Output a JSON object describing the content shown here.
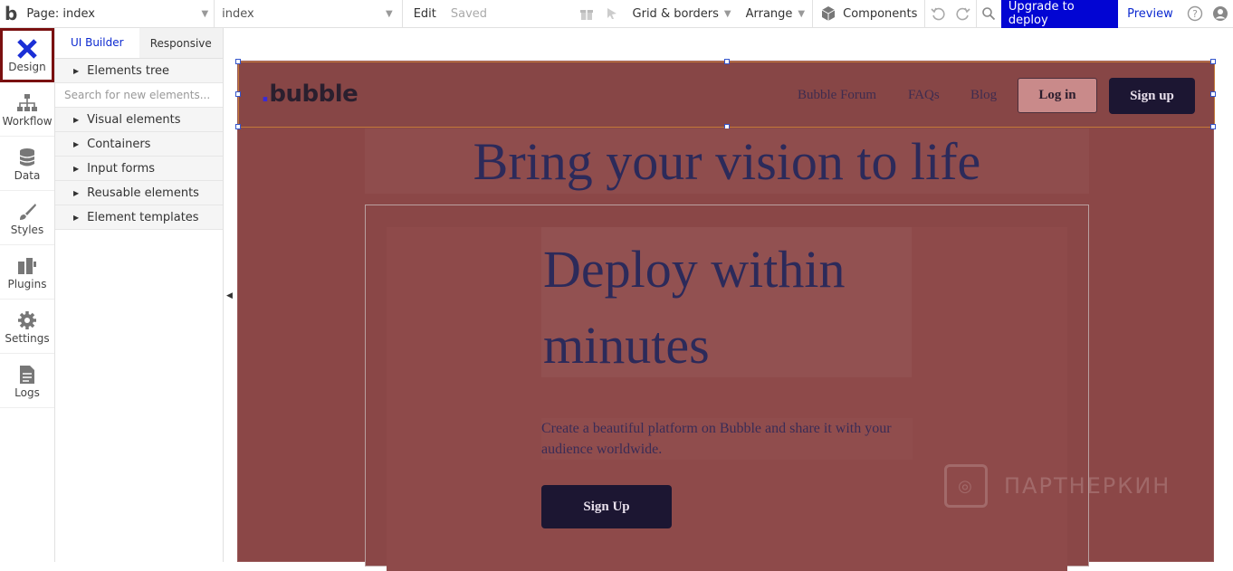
{
  "topbar": {
    "logo": "b",
    "page_label": "Page: index",
    "element_label": "index",
    "edit": "Edit",
    "saved": "Saved",
    "grid_borders": "Grid & borders",
    "arrange": "Arrange",
    "components": "Components",
    "upgrade": "Upgrade to deploy",
    "preview": "Preview",
    "accent": "#0205d3"
  },
  "sidebar": {
    "items": [
      {
        "label": "Design",
        "icon": "design-icon"
      },
      {
        "label": "Workflow",
        "icon": "workflow-icon"
      },
      {
        "label": "Data",
        "icon": "database-icon"
      },
      {
        "label": "Styles",
        "icon": "brush-icon"
      },
      {
        "label": "Plugins",
        "icon": "plug-icon"
      },
      {
        "label": "Settings",
        "icon": "gear-icon"
      },
      {
        "label": "Logs",
        "icon": "document-icon"
      }
    ]
  },
  "panel": {
    "tabs": [
      "UI Builder",
      "Responsive"
    ],
    "elements_tree": "Elements tree",
    "search_placeholder": "Search for new elements...",
    "categories": [
      "Visual elements",
      "Containers",
      "Input forms",
      "Reusable elements",
      "Element templates"
    ]
  },
  "canvas": {
    "logo": "bubble",
    "nav_links": [
      "Bubble Forum",
      "FAQs",
      "Blog"
    ],
    "login": "Log in",
    "signup": "Sign up",
    "hero_title": "Bring your vision to life",
    "deploy_title": "Deploy within minutes",
    "description": "Create a beautiful platform on Bubble and share it with your audience worldwide.",
    "cta": "Sign Up",
    "background": "#8b4747"
  },
  "watermark": "ПАРТНЕРКИН"
}
